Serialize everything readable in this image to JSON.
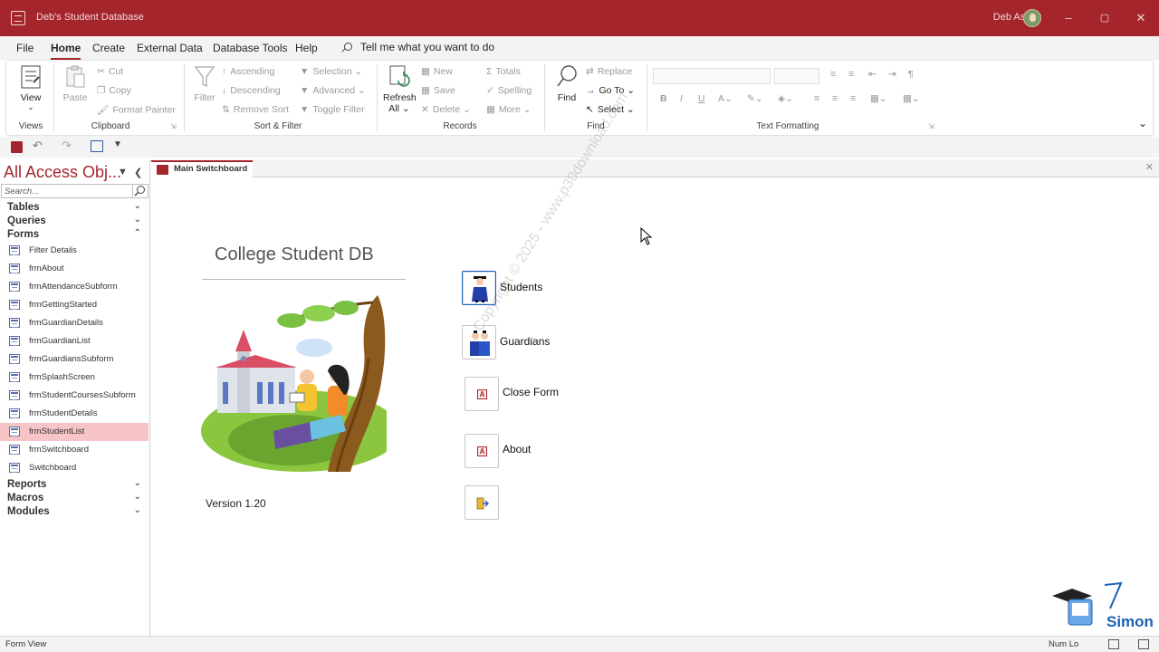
{
  "window": {
    "title": "Deb's Student Database",
    "user": "Deb Ashby"
  },
  "menu": {
    "items": [
      "File",
      "Home",
      "Create",
      "External Data",
      "Database Tools",
      "Help"
    ],
    "active": "Home",
    "tell_me": "Tell me what you want to do"
  },
  "ribbon": {
    "views": {
      "label": "Views",
      "view": "View"
    },
    "clipboard": {
      "label": "Clipboard",
      "paste": "Paste",
      "cut": "Cut",
      "copy": "Copy",
      "format_painter": "Format Painter"
    },
    "sort_filter": {
      "label": "Sort & Filter",
      "filter": "Filter",
      "ascending": "Ascending",
      "descending": "Descending",
      "remove_sort": "Remove Sort",
      "selection": "Selection",
      "advanced": "Advanced",
      "toggle_filter": "Toggle Filter"
    },
    "records": {
      "label": "Records",
      "refresh": "Refresh",
      "refresh_all": "All",
      "new": "New",
      "save": "Save",
      "delete": "Delete",
      "totals": "Totals",
      "spelling": "Spelling",
      "more": "More"
    },
    "find": {
      "label": "Find",
      "find": "Find",
      "replace": "Replace",
      "goto": "Go To",
      "select": "Select"
    },
    "text_formatting": {
      "label": "Text Formatting",
      "bold": "B",
      "italic": "I",
      "underline": "U"
    }
  },
  "nav": {
    "title": "All Access Obj...",
    "search_placeholder": "Search...",
    "categories": {
      "tables": "Tables",
      "queries": "Queries",
      "forms": "Forms",
      "reports": "Reports",
      "macros": "Macros",
      "modules": "Modules"
    },
    "forms": [
      "Filter Details",
      "frmAbout",
      "frmAttendanceSubform",
      "frmGettingStarted",
      "frmGuardianDetails",
      "frmGuardianList",
      "frmGuardiansSubform",
      "frmSplashScreen",
      "frmStudentCoursesSubform",
      "frmStudentDetails",
      "frmStudentList",
      "frmSwitchboard",
      "Switchboard"
    ],
    "selected": "frmStudentList"
  },
  "document": {
    "tab": "Main Switchboard"
  },
  "switchboard": {
    "title": "College Student DB",
    "version": "Version 1.20",
    "buttons": [
      "Students",
      "Guardians",
      "Close Form",
      "About"
    ]
  },
  "watermark": "Copyright © 2025 - www.p30download.com",
  "status": {
    "left": "Form View",
    "right": "Num Lo"
  },
  "logo": {
    "text": "Simon"
  },
  "colors": {
    "accent": "#a4262c",
    "selection": "#f7c4c8"
  }
}
